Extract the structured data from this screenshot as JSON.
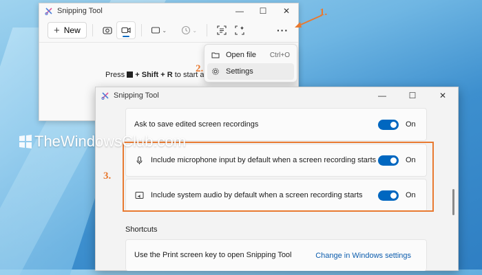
{
  "window1": {
    "title": "Snipping Tool",
    "controls": {
      "minimize": "—",
      "maximize": "☐",
      "close": "✕"
    },
    "new_label": "New",
    "more_label": "···",
    "hint_prefix": "Press",
    "hint_keys_mid": "+ Shift + R",
    "hint_suffix": "to start a r"
  },
  "menu": {
    "items": [
      {
        "label": "Open file",
        "shortcut": "Ctrl+O"
      },
      {
        "label": "Settings",
        "shortcut": ""
      }
    ]
  },
  "window2": {
    "title": "Snipping Tool",
    "controls": {
      "minimize": "—",
      "maximize": "☐",
      "close": "✕"
    },
    "rows": [
      {
        "label": "Ask to save edited screen recordings",
        "state": "On",
        "icon": ""
      },
      {
        "label": "Include microphone input by default when a screen recording starts",
        "state": "On",
        "icon": "microphone-icon"
      },
      {
        "label": "Include system audio by default when a screen recording starts",
        "state": "On",
        "icon": "speaker-icon"
      }
    ],
    "section_title": "Shortcuts",
    "shortcut_row": {
      "label": "Use the Print screen key to open Snipping Tool",
      "link": "Change in Windows settings"
    }
  },
  "callouts": {
    "one": "1.",
    "two": "2.",
    "three": "3."
  },
  "watermark": "TheWindowsClub.com",
  "colors": {
    "accent": "#0067c0",
    "callout": "#e8792f",
    "link": "#0b5cad"
  }
}
